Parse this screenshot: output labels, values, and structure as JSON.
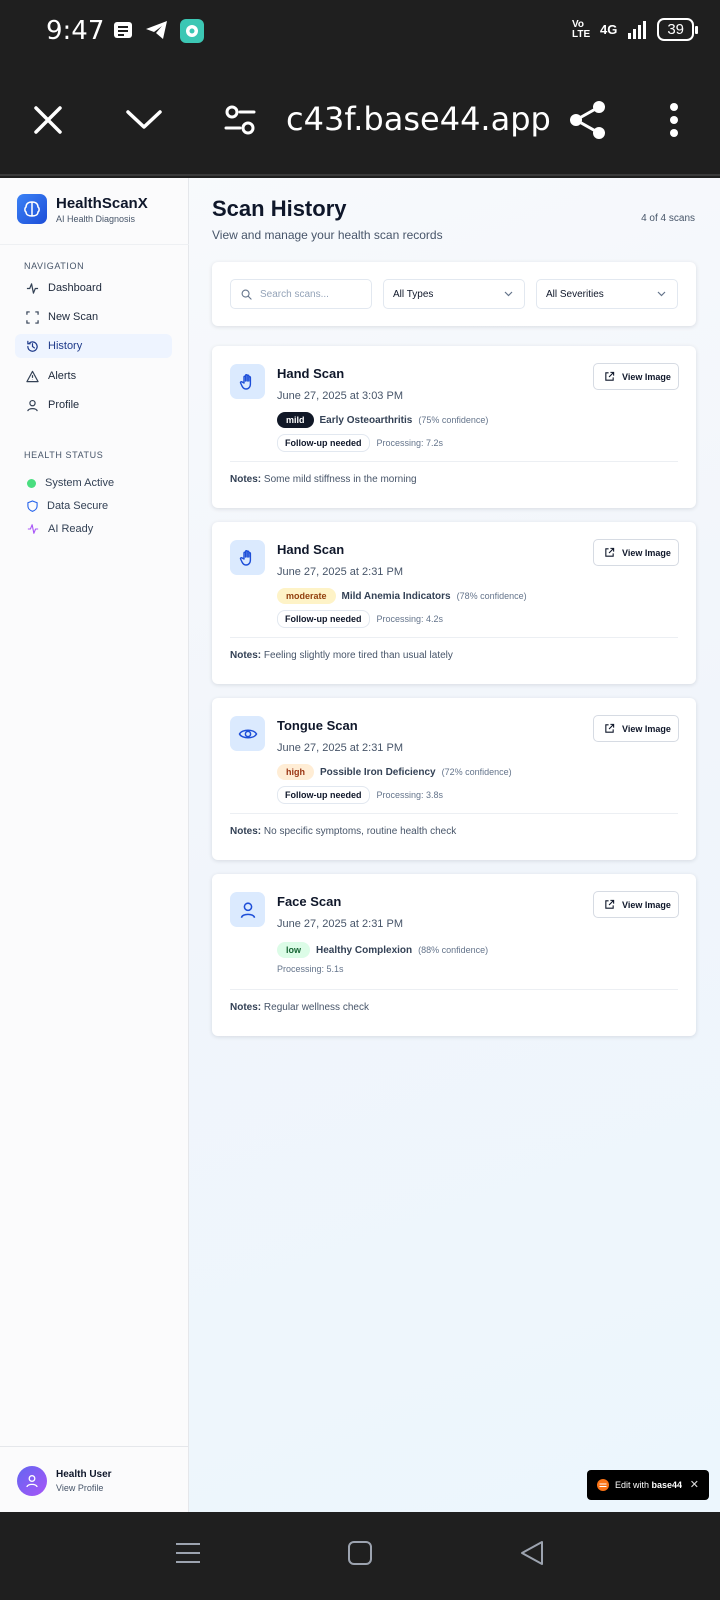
{
  "status_bar": {
    "time": "9:47",
    "network": "4G",
    "volte": "Vo LTE",
    "battery": "39"
  },
  "browser": {
    "url": "c43f.base44.app"
  },
  "app": {
    "name": "HealthScanX",
    "tagline": "AI Health Diagnosis",
    "nav_label": "NAVIGATION",
    "nav": [
      {
        "label": "Dashboard",
        "icon": "activity-icon"
      },
      {
        "label": "New Scan",
        "icon": "scan-icon"
      },
      {
        "label": "History",
        "icon": "history-icon",
        "active": true
      },
      {
        "label": "Alerts",
        "icon": "alert-triangle-icon"
      },
      {
        "label": "Profile",
        "icon": "user-icon"
      }
    ],
    "health_label": "HEALTH STATUS",
    "health": [
      {
        "label": "System Active",
        "icon": "green-dot"
      },
      {
        "label": "Data Secure",
        "icon": "shield-icon"
      },
      {
        "label": "AI Ready",
        "icon": "activity-icon"
      }
    ],
    "user": {
      "name": "Health User",
      "link": "View Profile"
    }
  },
  "page": {
    "title": "Scan History",
    "subtitle": "View and manage your health scan records",
    "count": "4 of 4 scans",
    "search_placeholder": "Search scans...",
    "type_filter": "All Types",
    "severity_filter": "All Severities"
  },
  "scans": [
    {
      "title": "Hand Scan",
      "icon": "hand-icon",
      "date": "June 27, 2025 at 3:03 PM",
      "severity": "mild",
      "diagnosis": "Early Osteoarthritis",
      "confidence": "(75% confidence)",
      "follow_up": "Follow-up needed",
      "processing": "Processing: 7.2s",
      "notes_label": "Notes:",
      "notes": "Some mild stiffness in the morning",
      "view": "View Image"
    },
    {
      "title": "Hand Scan",
      "icon": "hand-icon",
      "date": "June 27, 2025 at 2:31 PM",
      "severity": "moderate",
      "diagnosis": "Mild Anemia Indicators",
      "confidence": "(78% confidence)",
      "follow_up": "Follow-up needed",
      "processing": "Processing: 4.2s",
      "notes_label": "Notes:",
      "notes": "Feeling slightly more tired than usual lately",
      "view": "View Image"
    },
    {
      "title": "Tongue Scan",
      "icon": "eye-icon",
      "date": "June 27, 2025 at 2:31 PM",
      "severity": "high",
      "diagnosis": "Possible Iron Deficiency",
      "confidence": "(72% confidence)",
      "follow_up": "Follow-up needed",
      "processing": "Processing: 3.8s",
      "notes_label": "Notes:",
      "notes": "No specific symptoms, routine health check",
      "view": "View Image"
    },
    {
      "title": "Face Scan",
      "icon": "user-icon",
      "date": "June 27, 2025 at 2:31 PM",
      "severity": "low",
      "diagnosis": "Healthy Complexion",
      "confidence": "(88% confidence)",
      "follow_up": "",
      "processing": "Processing: 5.1s",
      "notes_label": "Notes:",
      "notes": "Regular wellness check",
      "view": "View Image"
    }
  ],
  "edit_badge": {
    "prefix": "Edit with",
    "brand": "base44"
  },
  "colors": {
    "accent": "#2563eb",
    "active_bg": "#eef4ff",
    "brand_logo": "#3b82f6"
  }
}
